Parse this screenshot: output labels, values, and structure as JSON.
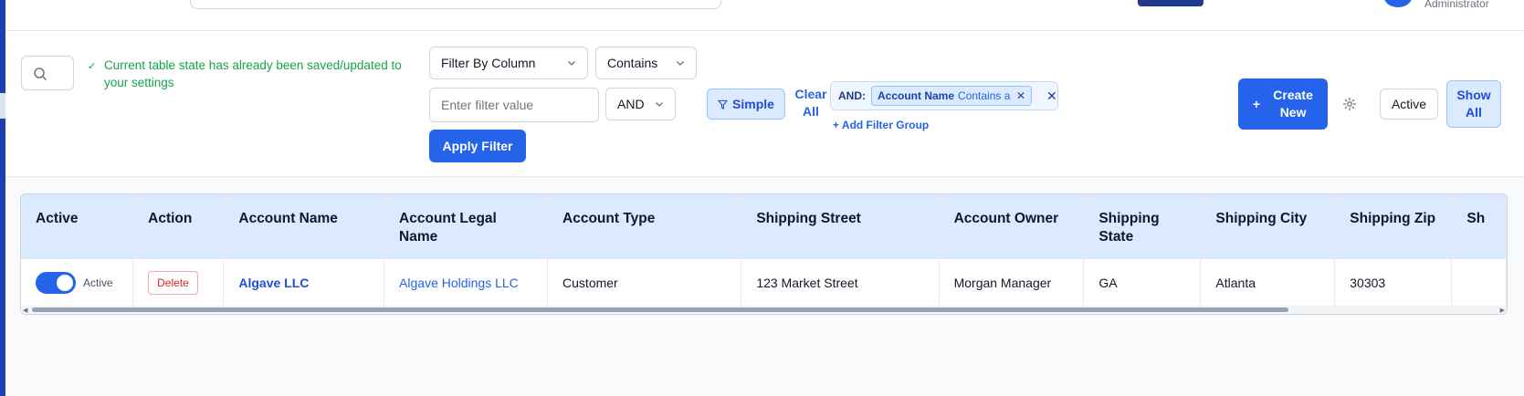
{
  "topbar": {
    "role": "Administrator"
  },
  "toolbar": {
    "saved_message": "Current table state has already been saved/updated to your settings",
    "filter_column": "Filter By Column",
    "filter_operator": "Contains",
    "filter_value_placeholder": "Enter filter value",
    "logic_operator": "AND",
    "apply_label": "Apply Filter",
    "simple_label": "Simple",
    "clear_all_label": "Clear All",
    "filter_group": {
      "logic": "AND:",
      "chip_field": "Account Name",
      "chip_condition": "Contains a"
    },
    "add_group_label": "+ Add Filter Group",
    "create_label": "Create New",
    "status_select": "Active",
    "show_all_label": "Show All"
  },
  "table": {
    "columns": [
      "Active",
      "Action",
      "Account Name",
      "Account Legal Name",
      "Account Type",
      "Shipping Street",
      "Account Owner",
      "Shipping State",
      "Shipping City",
      "Shipping Zip",
      "Sh"
    ],
    "rows": [
      {
        "active_label": "Active",
        "action_label": "Delete",
        "account_name": "Algave LLC",
        "legal_name": "Algave Holdings LLC",
        "account_type": "Customer",
        "shipping_street": "123 Market Street",
        "account_owner": "Morgan Manager",
        "shipping_state": "GA",
        "shipping_city": "Atlanta",
        "shipping_zip": "30303"
      }
    ]
  },
  "icons": {
    "search": "search-icon",
    "check": "check-icon",
    "chevron": "chevron-down-icon",
    "filter": "filter-icon",
    "close": "close-icon",
    "plus": "plus-icon",
    "gear": "gear-icon"
  },
  "colors": {
    "primary": "#2563eb",
    "success": "#16a34a",
    "danger": "#dc2626",
    "header_bg": "#dbeafe"
  }
}
